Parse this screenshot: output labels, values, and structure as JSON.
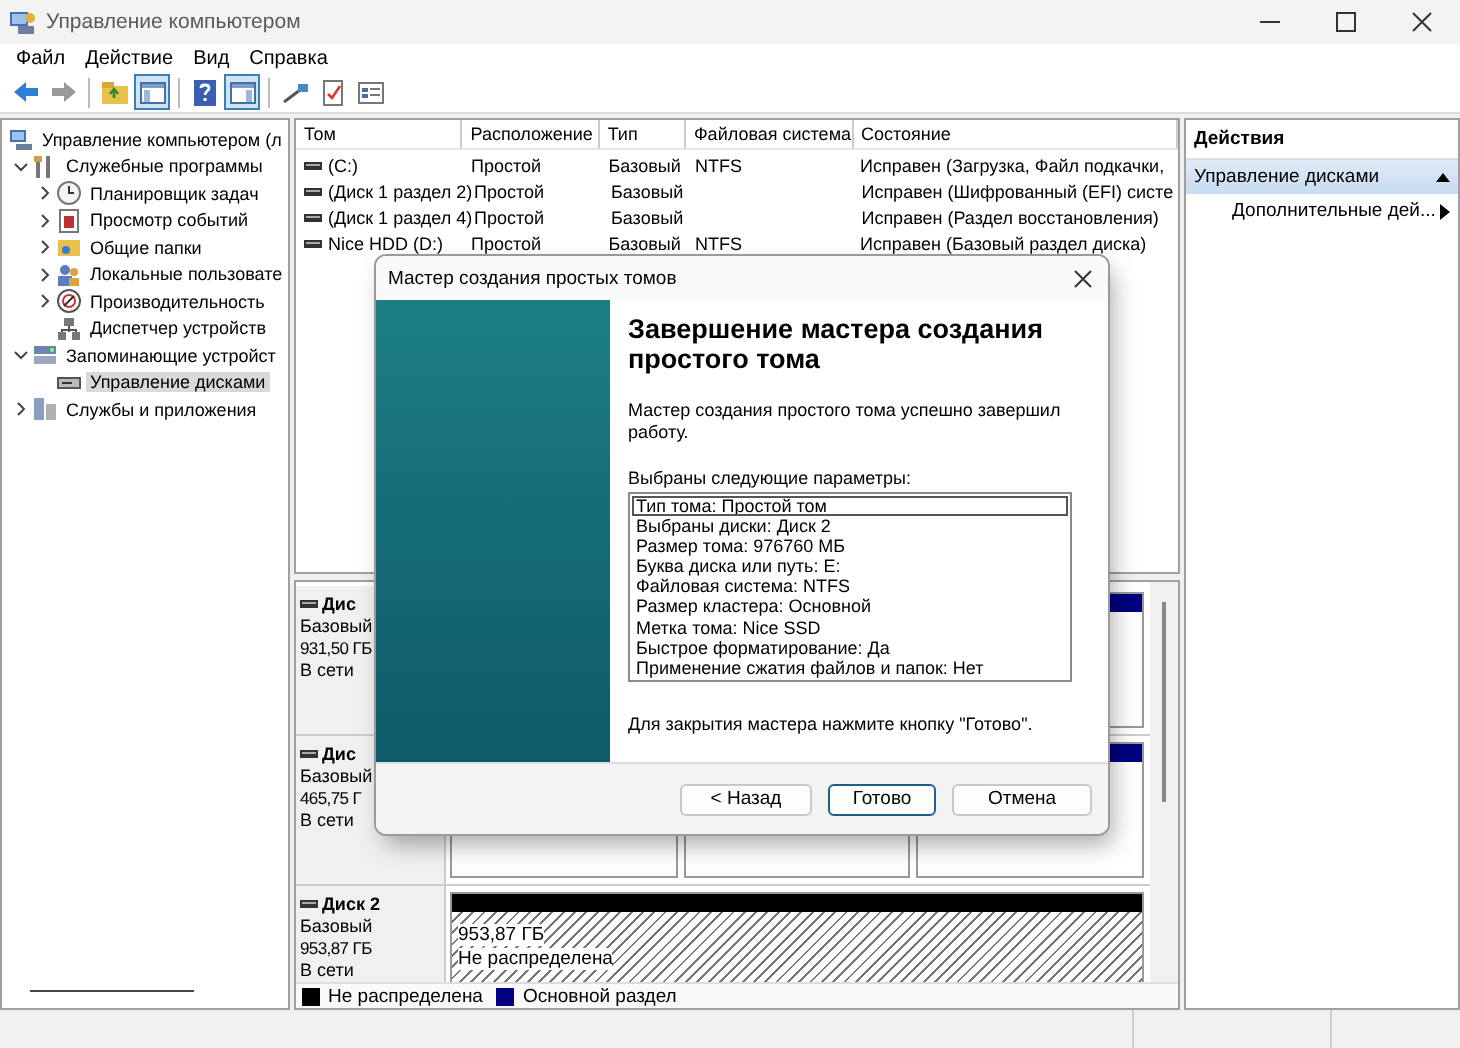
{
  "window": {
    "title": "Управление компьютером"
  },
  "menu": [
    "Файл",
    "Действие",
    "Вид",
    "Справка"
  ],
  "toolbar": [
    {
      "pressed": false
    },
    {
      "pressed": false
    },
    {
      "pressed": false
    },
    {
      "pressed": true
    },
    {
      "pressed": false
    },
    {
      "pressed": true
    },
    {
      "pressed": false
    },
    {
      "pressed": false
    },
    {
      "pressed": false
    }
  ],
  "tree": [
    {
      "label": "Управление компьютером (л",
      "selected": false,
      "children": [
        {
          "label": "Служебные программы",
          "expanded": true,
          "selected": false,
          "children": [
            {
              "label": "Планировщик задач",
              "expanded": false,
              "selected": false
            },
            {
              "label": "Просмотр событий",
              "expanded": false,
              "selected": false
            },
            {
              "label": "Общие папки",
              "expanded": false,
              "selected": false
            },
            {
              "label": "Локальные пользовате",
              "expanded": false,
              "selected": false
            },
            {
              "label": "Производительность",
              "expanded": false,
              "selected": false
            },
            {
              "label": "Диспетчер устройств",
              "selected": false
            }
          ]
        },
        {
          "label": "Запоминающие устройст",
          "expanded": true,
          "selected": false,
          "children": [
            {
              "label": "Управление дисками",
              "selected": true
            }
          ]
        },
        {
          "label": "Службы и приложения",
          "expanded": false,
          "selected": false
        }
      ]
    }
  ],
  "volumes": {
    "columns": [
      "Том",
      "Расположение",
      "Тип",
      "Файловая система",
      "Состояние"
    ],
    "rows": [
      {
        "volume": "(C:)",
        "layout": "Простой",
        "type": "Базовый",
        "file_system": "NTFS",
        "status": "Исправен (Загрузка, Файл подкачки,"
      },
      {
        "volume": "(Диск 1 раздел 2)",
        "layout": "Простой",
        "type": "Базовый",
        "status": "Исправен (Шифрованный (EFI) систе"
      },
      {
        "volume": "(Диск 1 раздел 4)",
        "layout": "Простой",
        "type": "Базовый",
        "status": "Исправен (Раздел восстановления)"
      },
      {
        "volume": "Nice HDD (D:)",
        "layout": "Простой",
        "type": "Базовый",
        "file_system": "NTFS",
        "status": "Исправен (Базовый раздел диска)"
      }
    ]
  },
  "disks": [
    {
      "name": "Дис",
      "type": "Базовый",
      "size": "931,50 ГБ",
      "state": "В сети",
      "partitions": [
        {
          "kind": "primary"
        }
      ]
    },
    {
      "name": "Дис",
      "type": "Базовый",
      "size": "465,75 Г",
      "state": "В сети",
      "partitions": [
        {
          "kind": "primary"
        },
        {
          "kind": "primary"
        },
        {
          "kind": "primary"
        }
      ]
    },
    {
      "name": "Диск 2",
      "type": "Базовый",
      "size": "953,87 ГБ",
      "state": "В сети",
      "partitions": [
        {
          "kind": "unallocated",
          "size": "953,87 ГБ",
          "status": "Не распределена"
        }
      ]
    }
  ],
  "legend": [
    {
      "label": "Не распределена",
      "color": "#000000"
    },
    {
      "label": "Основной раздел",
      "color": "#000080"
    }
  ],
  "actions": {
    "title": "Действия",
    "items": [
      {
        "kind": "section",
        "label": "Управление дисками",
        "expanded": true
      },
      {
        "kind": "submenu",
        "label": "Дополнительные дей..."
      }
    ]
  },
  "dialog": {
    "title": "Мастер создания простых томов",
    "heading": "Завершение мастера создания простого тома",
    "message": "Мастер создания простого тома успешно завершил работу.",
    "params_label": "Выбраны следующие параметры:",
    "params": [
      {
        "text": "Тип тома: Простой том",
        "selected": true
      },
      {
        "text": "Выбраны диски: Диск 2",
        "selected": false
      },
      {
        "text": "Размер тома: 976760 МБ",
        "selected": false
      },
      {
        "text": "Буква диска или путь: E:",
        "selected": false
      },
      {
        "text": "Файловая система: NTFS",
        "selected": false
      },
      {
        "text": "Размер кластера: Основной",
        "selected": false
      },
      {
        "text": "Метка тома: Nice SSD",
        "selected": false
      },
      {
        "text": "Быстрое форматирование: Да",
        "selected": false
      },
      {
        "text": "Применение сжатия файлов и папок: Нет",
        "selected": false
      }
    ],
    "note": "Для закрытия мастера нажмите кнопку \"Готово\".",
    "buttons": [
      {
        "label": "< Назад",
        "default": false
      },
      {
        "label": "Готово",
        "default": true
      },
      {
        "label": "Отмена",
        "default": false
      }
    ]
  }
}
